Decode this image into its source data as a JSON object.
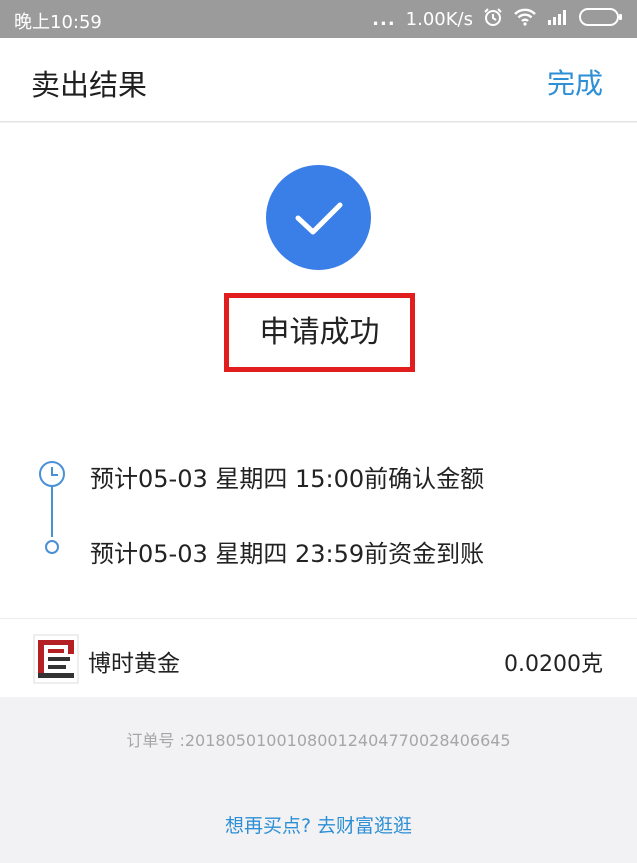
{
  "status_bar": {
    "time": "晚上10:59",
    "dots": "...",
    "speed": "1.00K/s",
    "icons": [
      "alarm-icon",
      "wifi-icon",
      "signal-icon",
      "battery-icon"
    ]
  },
  "header": {
    "title": "卖出结果",
    "done_label": "完成"
  },
  "result": {
    "icon": "check-icon",
    "accent_color": "#3a7ee8",
    "status_text": "申请成功",
    "highlight_color": "#e11d1d"
  },
  "timeline": {
    "steps": [
      {
        "icon": "clock-icon",
        "text": "预计05-03 星期四 15:00前确认金额"
      },
      {
        "icon": "dot-icon",
        "text": "预计05-03 星期四 23:59前资金到账"
      }
    ]
  },
  "product": {
    "logo": "bosera-logo",
    "name": "博时黄金",
    "amount": "0.0200克"
  },
  "order": {
    "number_text": "订单号 :2018050100108001240477002840664​5"
  },
  "footer": {
    "buy_more_link": "想再买点? 去财富逛逛",
    "link_color": "#2d8fd5"
  }
}
